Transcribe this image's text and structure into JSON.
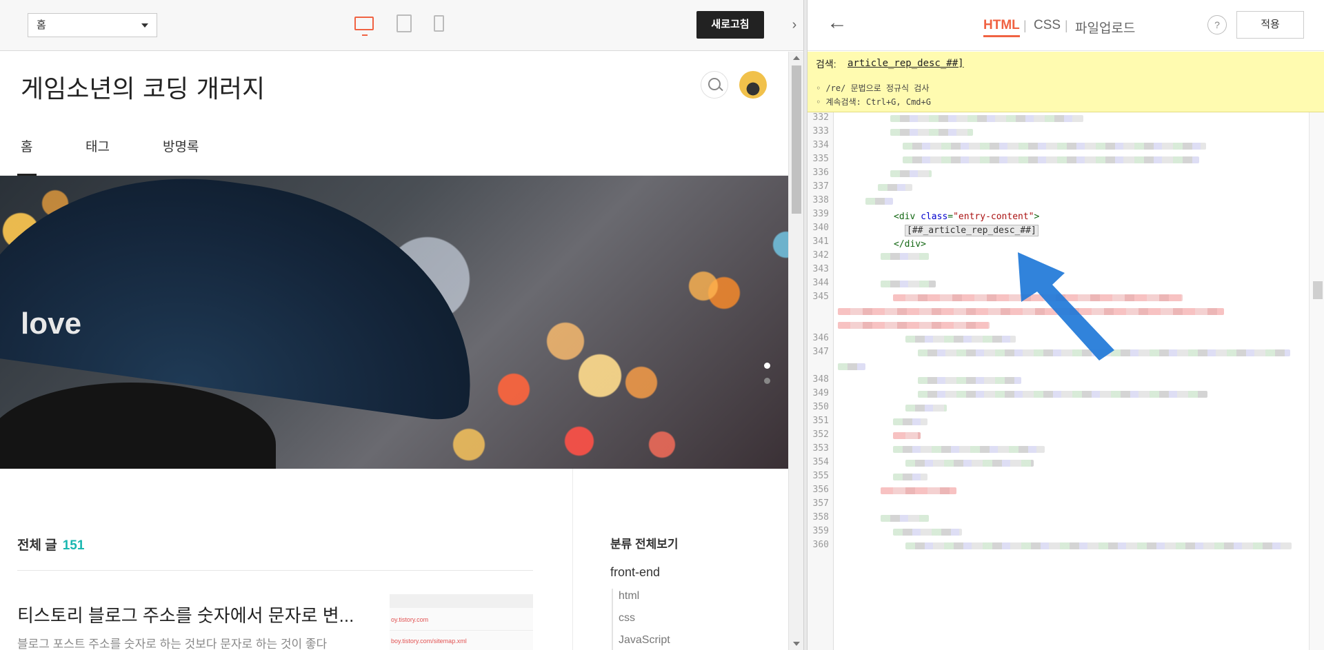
{
  "left_toolbar": {
    "page_select": "홈",
    "refresh_label": "새로고침",
    "collapse_glyph": "›"
  },
  "blog": {
    "title": "게임소년의 코딩 개러지",
    "nav": [
      "홈",
      "태그",
      "방명록"
    ],
    "hero_text": "love",
    "all_posts_label": "전체 글",
    "all_posts_count": "151",
    "post": {
      "title": "티스토리 블로그 주소를 숫자에서 문자로 변...",
      "excerpt": "블로그 포스트 주소를 숫자로 하는 것보다 문자로 하는 것이 좋다",
      "thumb_line1": "oy.tistory.com",
      "thumb_line2": "boy.tistory.com/sitemap.xml"
    },
    "category": {
      "title": "분류 전체보기",
      "group": "front-end",
      "children": [
        "html",
        "css",
        "JavaScript"
      ]
    }
  },
  "editor": {
    "back_glyph": "←",
    "tabs": [
      "HTML",
      "CSS",
      "파일업로드"
    ],
    "separator": "|",
    "help_glyph": "?",
    "apply_label": "적용",
    "search": {
      "label": "검색:",
      "value": "article_rep_desc_##]",
      "hints": [
        "◦ /re/ 문법으로 정규식 검사",
        "◦ 계속검색: Ctrl+G, Cmd+G"
      ]
    },
    "line_numbers": [
      "332",
      "333",
      "334",
      "335",
      "336",
      "337",
      "338",
      "339",
      "340",
      "341",
      "342",
      "343",
      "344",
      "345",
      "346",
      "347",
      "348",
      "349",
      "350",
      "351",
      "352",
      "353",
      "354",
      "355",
      "356",
      "357",
      "358",
      "359",
      "360"
    ],
    "code": {
      "l339_open": "<div ",
      "l339_attr": "class",
      "l339_eq": "=",
      "l339_str": "\"entry-content\"",
      "l339_close": ">",
      "l340": "[##_article_rep_desc_##]",
      "l341": "</div>"
    }
  },
  "colors": {
    "accent": "#f06242",
    "count": "#19b7b0",
    "search_bg": "#fffbb0",
    "arrow": "#1f78d8"
  }
}
